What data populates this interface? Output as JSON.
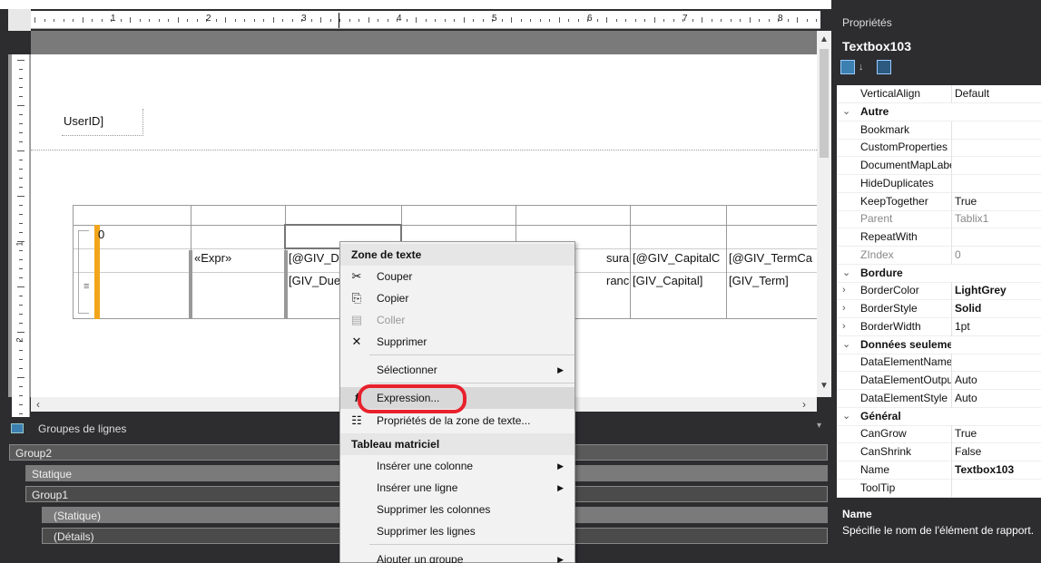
{
  "ruler": {
    "numbers": [
      "1",
      "2",
      "3",
      "4",
      "5",
      "6",
      "7",
      "8"
    ],
    "vnumbers": [
      "1",
      "2"
    ]
  },
  "report": {
    "userid_cell": "UserID]",
    "row_marker": "0",
    "expr": "«Expr»",
    "cells_row1": [
      "[@GIV_D",
      "suranceC",
      "[@GIV_CapitalC",
      "[@GIV_TermCa"
    ],
    "cells_row2": [
      "[GIV_Due",
      "rance]",
      "[GIV_Capital]",
      "[GIV_Term]"
    ]
  },
  "row_groups": {
    "title": "Groupes de lignes",
    "items": [
      "Group2",
      "Statique",
      "Group1",
      "(Statique)",
      "(Détails)"
    ]
  },
  "context_menu": {
    "section1": "Zone de texte",
    "cut": "Couper",
    "copy": "Copier",
    "paste": "Coller",
    "delete": "Supprimer",
    "select": "Sélectionner",
    "expression": "Expression...",
    "textbox_props": "Propriétés de la zone de texte...",
    "section2": "Tableau matriciel",
    "insert_col": "Insérer une colonne",
    "insert_row": "Insérer une ligne",
    "delete_cols": "Supprimer les colonnes",
    "delete_rows": "Supprimer les lignes",
    "add_group": "Ajouter un groupe"
  },
  "properties": {
    "title": "Propriétés",
    "object": "Textbox103",
    "rows": [
      {
        "k": "VerticalAlign",
        "v": "Default",
        "type": "prop"
      },
      {
        "k": "Autre",
        "v": "",
        "type": "cat"
      },
      {
        "k": "Bookmark",
        "v": "",
        "type": "prop"
      },
      {
        "k": "CustomProperties",
        "v": "",
        "type": "prop"
      },
      {
        "k": "DocumentMapLabel",
        "v": "",
        "type": "prop"
      },
      {
        "k": "HideDuplicates",
        "v": "",
        "type": "prop"
      },
      {
        "k": "KeepTogether",
        "v": "True",
        "type": "prop"
      },
      {
        "k": "Parent",
        "v": "Tablix1",
        "type": "dim"
      },
      {
        "k": "RepeatWith",
        "v": "",
        "type": "prop"
      },
      {
        "k": "ZIndex",
        "v": "0",
        "type": "dim"
      },
      {
        "k": "Bordure",
        "v": "",
        "type": "cat"
      },
      {
        "k": "BorderColor",
        "v": "LightGrey",
        "type": "exp",
        "bold": true
      },
      {
        "k": "BorderStyle",
        "v": "Solid",
        "type": "exp",
        "bold": true
      },
      {
        "k": "BorderWidth",
        "v": "1pt",
        "type": "exp"
      },
      {
        "k": "Données seulement",
        "v": "",
        "type": "cat"
      },
      {
        "k": "DataElementName",
        "v": "",
        "type": "prop"
      },
      {
        "k": "DataElementOutput",
        "v": "Auto",
        "type": "prop"
      },
      {
        "k": "DataElementStyle",
        "v": "Auto",
        "type": "prop"
      },
      {
        "k": "Général",
        "v": "",
        "type": "cat"
      },
      {
        "k": "CanGrow",
        "v": "True",
        "type": "prop"
      },
      {
        "k": "CanShrink",
        "v": "False",
        "type": "prop"
      },
      {
        "k": "Name",
        "v": "Textbox103",
        "type": "prop",
        "bold": true
      },
      {
        "k": "ToolTip",
        "v": "",
        "type": "prop"
      }
    ],
    "desc_title": "Name",
    "desc_text": "Spécifie le nom de l'élément de rapport."
  }
}
